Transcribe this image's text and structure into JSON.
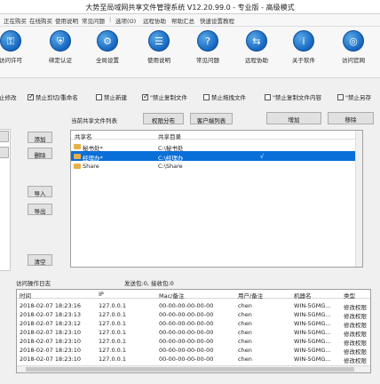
{
  "window": {
    "title": "大势至局域网共享文件管理系统 V12.20.99.0 - 专业版 - 高级模式"
  },
  "menu": [
    "正在购买",
    "在线购买",
    "使用说明",
    "常见问题",
    "|",
    "选项(O)",
    "远程协助",
    "帮助汇总",
    "快速设置教程"
  ],
  "toolbar": [
    {
      "label": "访问许可",
      "icon": "key-icon"
    },
    {
      "label": "绑定认证",
      "icon": "shield-icon"
    },
    {
      "label": "全局设置",
      "icon": "gear-icon"
    },
    {
      "label": "使用说明",
      "icon": "book-icon"
    },
    {
      "label": "常见问题",
      "icon": "question-icon"
    },
    {
      "label": "远程协助",
      "icon": "remote-icon"
    },
    {
      "label": "关于软件",
      "icon": "info-icon"
    },
    {
      "label": "访问官网",
      "icon": "globe-icon"
    }
  ],
  "options": [
    {
      "label": "止修改",
      "checked": false
    },
    {
      "label": "禁止剪切/重命名",
      "checked": true
    },
    {
      "label": "禁止新建",
      "checked": false
    },
    {
      "label": "\"禁止复制文件",
      "checked": true
    },
    {
      "label": "禁止拖拽文件",
      "checked": false
    },
    {
      "label": "\"禁止复制文件内容",
      "checked": false
    },
    {
      "label": "\"禁止另存",
      "checked": false
    }
  ],
  "share_list": {
    "label": "当前共享文件列表",
    "buttons": {
      "perm": "权限分布",
      "client": "客户端列表",
      "add": "增加",
      "remove": "移除"
    },
    "columns": [
      "共享名",
      "共享目录"
    ],
    "rows": [
      {
        "name": "秘书处*",
        "path": "C:\\秘书处",
        "selected": false
      },
      {
        "name": "经理办*",
        "path": "C:\\经理办",
        "selected": true,
        "mark": "√"
      },
      {
        "name": "Share",
        "path": "C:\\Share",
        "selected": false
      }
    ]
  },
  "side_buttons": {
    "add": "添加",
    "delete": "删除",
    "import": "导入",
    "export": "导出",
    "clear": "清空"
  },
  "log": {
    "label": "访问操作日志",
    "status": "发送包:0, 接收包:0",
    "columns": [
      "时间",
      "IP",
      "Mac/备注",
      "用户/备注",
      "机器名",
      "类型"
    ],
    "rows": [
      [
        "2018-02-07 18:23:16",
        "127.0.0.1",
        "00-00-00-00-00-00",
        "chen",
        "WIN-5GMG...",
        "修改权限"
      ],
      [
        "2018-02-07 18:23:13",
        "127.0.0.1",
        "00-00-00-00-00-00",
        "chen",
        "WIN-5GMG...",
        "修改权限"
      ],
      [
        "2018-02-07 18:23:12",
        "127.0.0.1",
        "00-00-00-00-00-00",
        "chen",
        "WIN-5GMG...",
        "修改权限"
      ],
      [
        "2018-02-07 18:23:10",
        "127.0.0.1",
        "00-00-00-00-00-00",
        "chen",
        "WIN-5GMG...",
        "修改权限"
      ],
      [
        "2018-02-07 18:23:10",
        "127.0.0.1",
        "00-00-00-00-00-00",
        "chen",
        "WIN-5GMG...",
        "修改权限"
      ],
      [
        "2018-02-07 18:23:10",
        "127.0.0.1",
        "00-00-00-00-00-00",
        "chen",
        "WIN-5GMG...",
        "修改权限"
      ],
      [
        "2018-02-07 18:23:10",
        "127.0.0.1",
        "00-00-00-00-00-00",
        "chen",
        "WIN-5GMG...",
        "修改权限"
      ]
    ]
  }
}
